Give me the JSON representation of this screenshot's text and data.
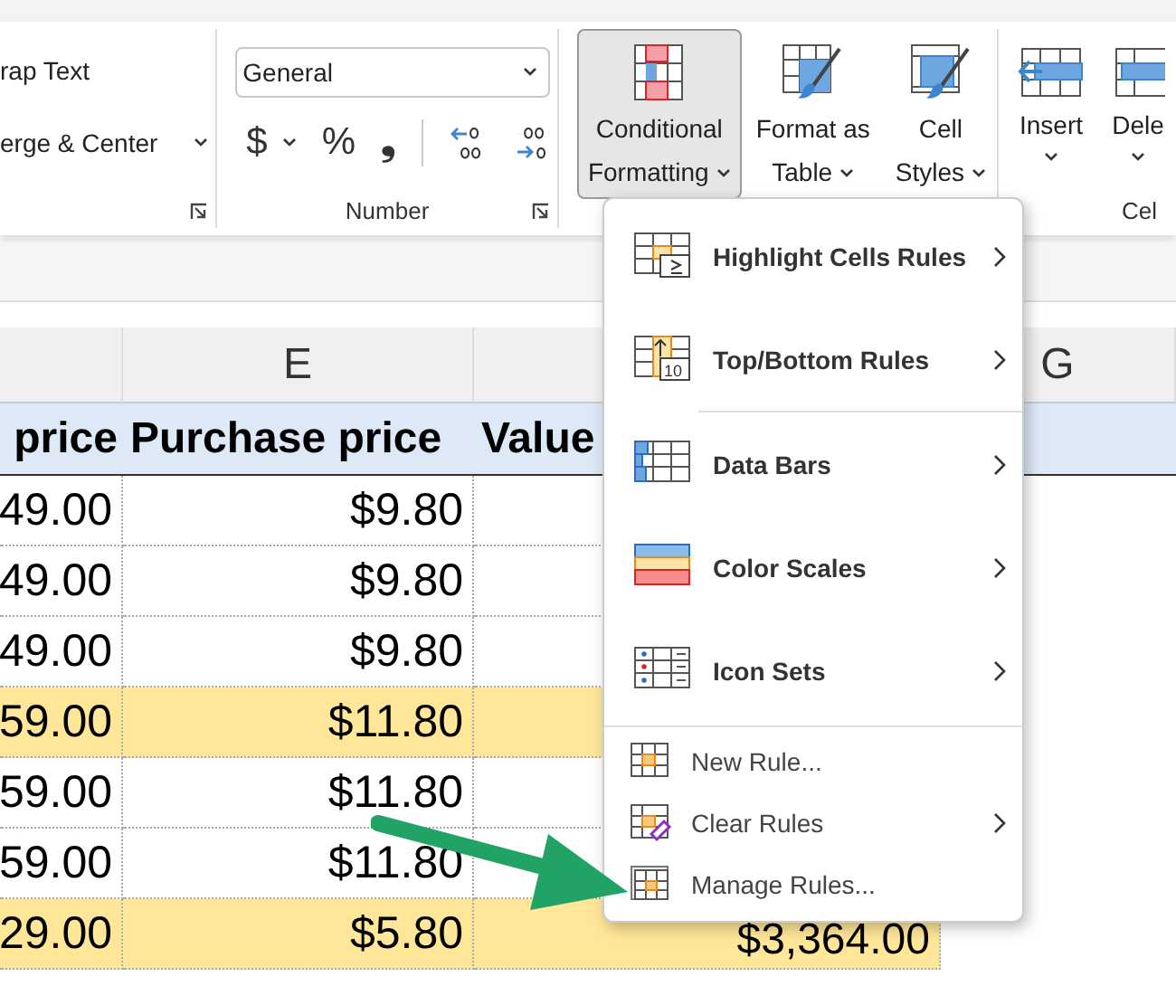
{
  "ribbon": {
    "alignment": {
      "wrap_text": "rap Text",
      "merge_center": "erge & Center"
    },
    "number": {
      "format": "General",
      "label": "Number",
      "currency": "$",
      "percent": "%",
      "comma": "❟"
    },
    "styles": [
      {
        "label": "Conditional Formatting",
        "selected": true
      },
      {
        "label": "Format as Table",
        "selected": false
      },
      {
        "label": "Cell Styles",
        "selected": false
      }
    ],
    "cells": [
      {
        "label": "Insert"
      },
      {
        "label": "Dele"
      }
    ],
    "cells_group_label": "Cel"
  },
  "sheet": {
    "column_headers": [
      "E",
      "G"
    ],
    "header_row": [
      "price",
      "Purchase price",
      "Value"
    ],
    "rows": [
      {
        "cells": [
          "49.00",
          "$9.80",
          ""
        ],
        "highlighted": false
      },
      {
        "cells": [
          "49.00",
          "$9.80",
          ""
        ],
        "highlighted": false
      },
      {
        "cells": [
          "49.00",
          "$9.80",
          ""
        ],
        "highlighted": false
      },
      {
        "cells": [
          "59.00",
          "$11.80",
          ""
        ],
        "highlighted": true
      },
      {
        "cells": [
          "59.00",
          "$11.80",
          ""
        ],
        "highlighted": false
      },
      {
        "cells": [
          "59.00",
          "$11.80",
          ""
        ],
        "highlighted": false
      },
      {
        "cells": [
          "29.00",
          "$5.80",
          "$3,364.00"
        ],
        "highlighted": true
      }
    ]
  },
  "menu": {
    "items": [
      {
        "label": "Highlight Cells Rules",
        "kind": "large",
        "submenu": true
      },
      {
        "label": "Top/Bottom Rules",
        "kind": "large",
        "submenu": true,
        "icon_number": "10"
      },
      {
        "kind": "separator"
      },
      {
        "label": "Data Bars",
        "kind": "large",
        "submenu": true
      },
      {
        "label": "Color Scales",
        "kind": "large",
        "submenu": true
      },
      {
        "label": "Icon Sets",
        "kind": "large",
        "submenu": true
      },
      {
        "kind": "separator"
      },
      {
        "label": "New Rule...",
        "kind": "small",
        "submenu": false
      },
      {
        "label": "Clear Rules",
        "kind": "small",
        "submenu": true
      },
      {
        "label": "Manage Rules...",
        "kind": "small",
        "submenu": false
      }
    ]
  }
}
